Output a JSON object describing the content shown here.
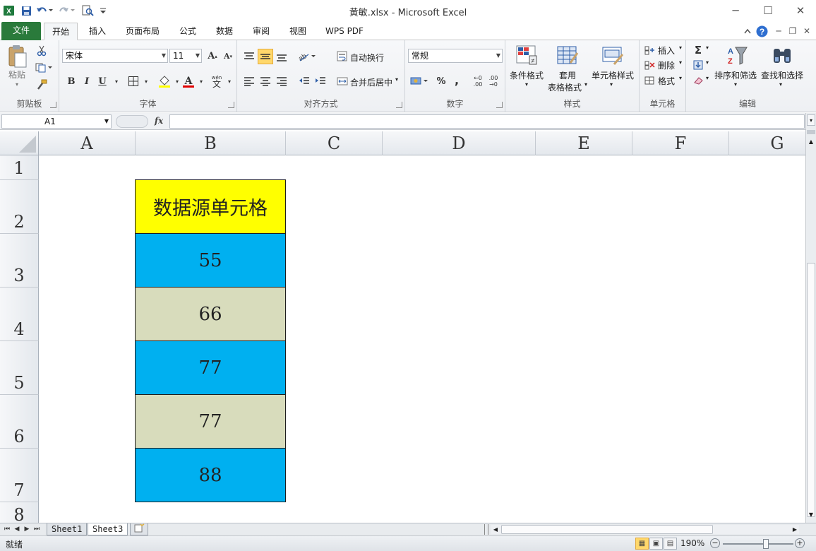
{
  "window": {
    "title": "黄敏.xlsx - Microsoft Excel"
  },
  "tabs": {
    "file": "文件",
    "items": [
      "开始",
      "插入",
      "页面布局",
      "公式",
      "数据",
      "审阅",
      "视图",
      "WPS PDF"
    ]
  },
  "ribbon": {
    "clipboard": {
      "paste": "粘贴",
      "label": "剪贴板"
    },
    "font": {
      "name": "宋体",
      "size": "11",
      "bold": "B",
      "italic": "I",
      "underline": "U",
      "label": "字体",
      "wen": "wén",
      "wen_char": "文"
    },
    "alignment": {
      "wrap": "自动换行",
      "merge": "合并后居中",
      "label": "对齐方式"
    },
    "number": {
      "format": "常规",
      "percent": "%",
      "comma": ",",
      "inc_decimal_top": "←0",
      "inc_decimal_bottom": ".00",
      "dec_decimal_top": ".00",
      "dec_decimal_bottom": "→0",
      "label": "数字"
    },
    "styles": {
      "conditional": "条件格式",
      "table_line1": "套用",
      "table_line2": "表格格式",
      "cell_styles": "单元格样式",
      "label": "样式"
    },
    "cells": {
      "insert": "插入",
      "delete": "删除",
      "format": "格式",
      "label": "单元格"
    },
    "editing": {
      "sigma": "Σ",
      "sort": "排序和筛选",
      "find": "查找和选择",
      "label": "编辑"
    }
  },
  "formula_bar": {
    "name_box": "A1",
    "fx": "fx",
    "content": ""
  },
  "grid": {
    "columns": [
      "A",
      "B",
      "C",
      "D",
      "E",
      "F",
      "G"
    ],
    "rows": [
      "1",
      "2",
      "3",
      "4",
      "5",
      "6",
      "7",
      "8"
    ],
    "cells": [
      {
        "ref": "B2",
        "value": "数据源单元格",
        "fill": "#ffff00"
      },
      {
        "ref": "B3",
        "value": "55",
        "fill": "#00b0f0"
      },
      {
        "ref": "B4",
        "value": "66",
        "fill": "#d8dcbc"
      },
      {
        "ref": "B5",
        "value": "77",
        "fill": "#00b0f0"
      },
      {
        "ref": "B6",
        "value": "77",
        "fill": "#d8dcbc"
      },
      {
        "ref": "B7",
        "value": "88",
        "fill": "#00b0f0"
      }
    ]
  },
  "sheets": {
    "tabs": [
      "Sheet1",
      "Sheet3"
    ],
    "active": "Sheet3"
  },
  "status": {
    "ready": "就绪",
    "zoom": "190%"
  }
}
